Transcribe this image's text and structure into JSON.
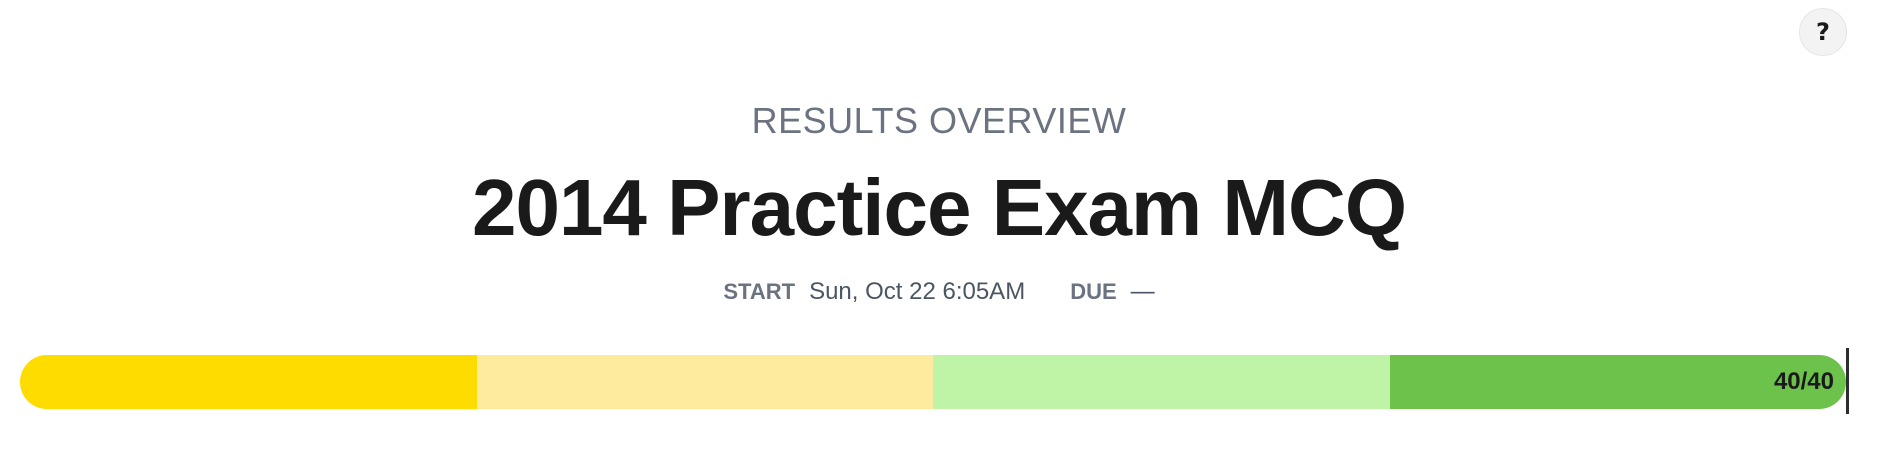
{
  "help": {
    "label": "?"
  },
  "header": {
    "overline": "RESULTS OVERVIEW",
    "title": "2014 Practice Exam MCQ",
    "start_label": "START",
    "start_value": "Sun, Oct 22 6:05AM",
    "due_label": "DUE",
    "due_value": "—"
  },
  "progress": {
    "score": 40,
    "total": 40,
    "score_text": "40/40",
    "segments": [
      {
        "color": "#ffdc00"
      },
      {
        "color": "#feeb9d"
      },
      {
        "color": "#bff4a6"
      },
      {
        "color": "#6cc24a"
      }
    ]
  }
}
